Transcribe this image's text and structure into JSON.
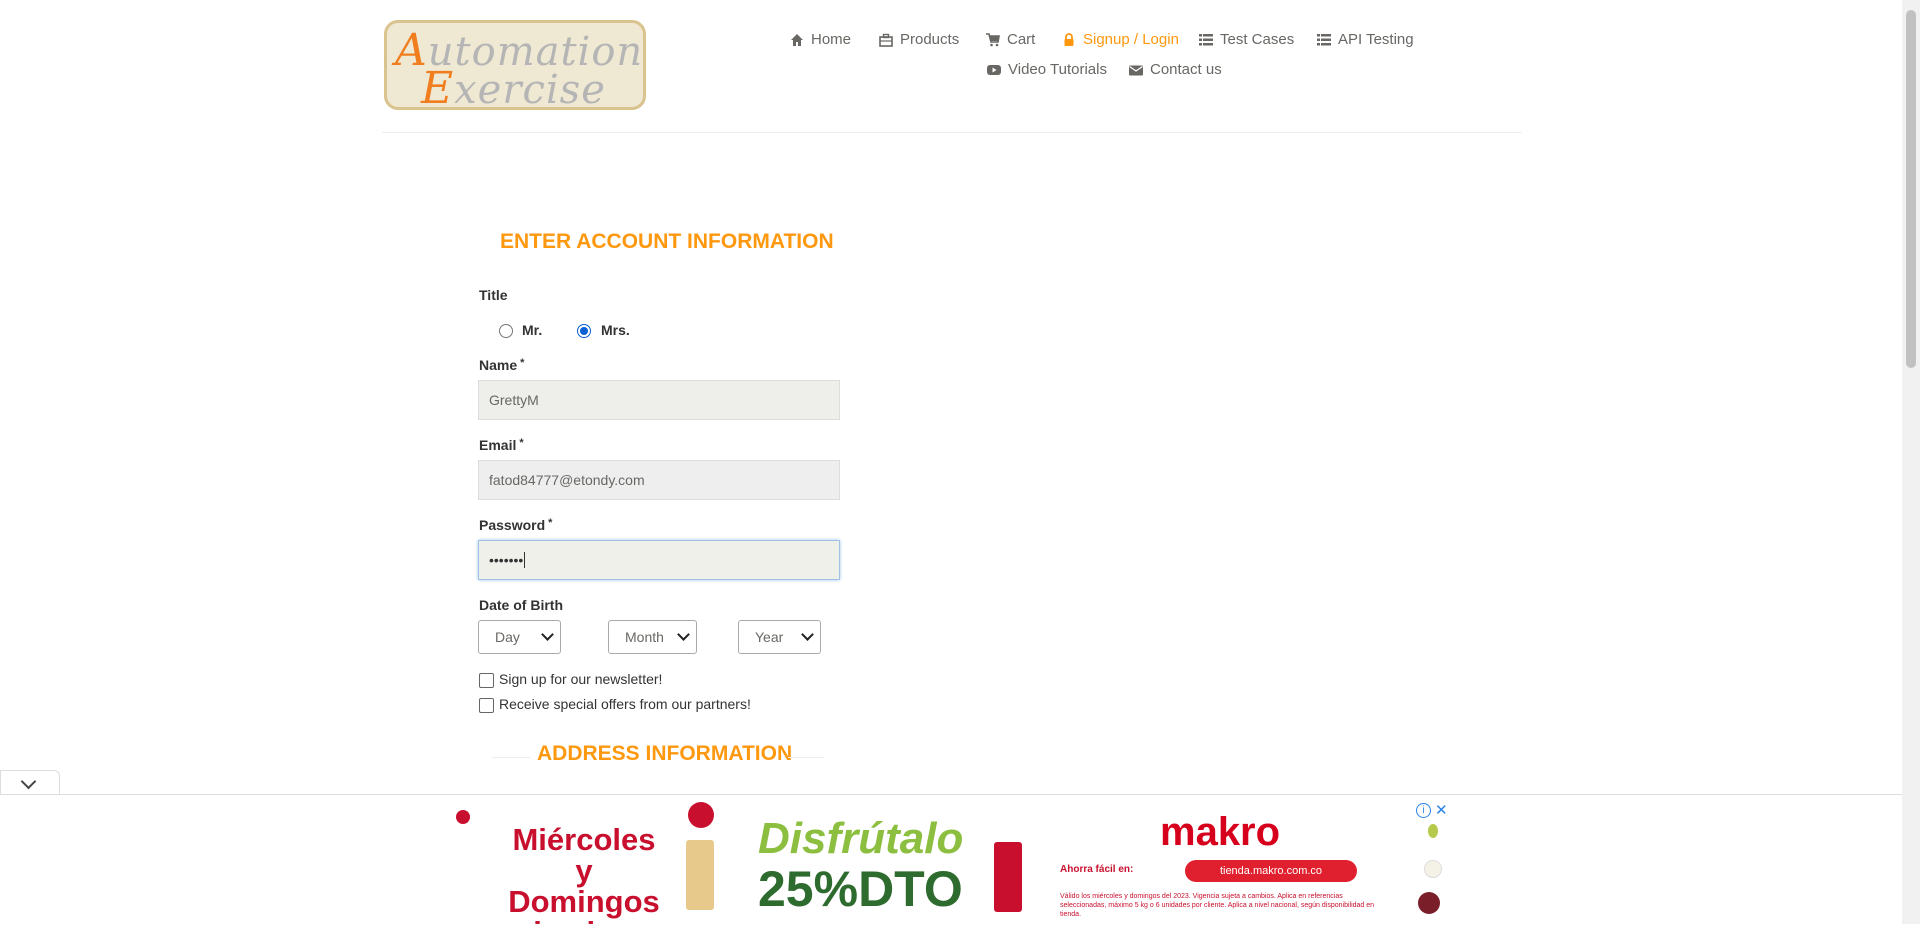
{
  "logo": {
    "line1_cap": "A",
    "line1_rest": "utomation",
    "line2_cap": "E",
    "line2_rest": "xercise"
  },
  "nav": {
    "home": "Home",
    "products": "Products",
    "cart": "Cart",
    "signup_login": "Signup / Login",
    "test_cases": "Test Cases",
    "api_testing": "API Testing",
    "video_tutorials": "Video Tutorials",
    "contact_us": "Contact us"
  },
  "form": {
    "heading": "ENTER ACCOUNT INFORMATION",
    "title_label": "Title",
    "title_options": [
      "Mr.",
      "Mrs."
    ],
    "title_selected": "Mrs.",
    "name_label": "Name",
    "name_value": "GrettyM",
    "email_label": "Email",
    "email_value": "fatod84777@etondy.com",
    "password_label": "Password",
    "password_value": "•••••••",
    "dob_label": "Date of Birth",
    "day": "Day",
    "month": "Month",
    "year": "Year",
    "newsletter": "Sign up for our newsletter!",
    "offers": "Receive special offers from our partners!",
    "required_mark": "*"
  },
  "address": {
    "heading": "ADDRESS INFORMATION"
  },
  "ad": {
    "text1": "Miércoles y Domingos de plaza",
    "text2": "Disfrútalo",
    "text3": "25%DTO",
    "brand": "makro",
    "cta_prefix": "Ahorra fácil en:",
    "url": "tienda.makro.com.co",
    "fine_print": "Válido los miércoles y domingos del 2023. Vigencia sujeta a cambios. Aplica en referencias seleccionadas, máximo 5 kg o 6 unidades por cliente. Aplica a nivel nacional, según disponibilidad en tienda.",
    "info": "i",
    "close": "✕"
  },
  "colors": {
    "accent": "#fe980f",
    "text": "#696763",
    "radio": "#0b61d5"
  }
}
